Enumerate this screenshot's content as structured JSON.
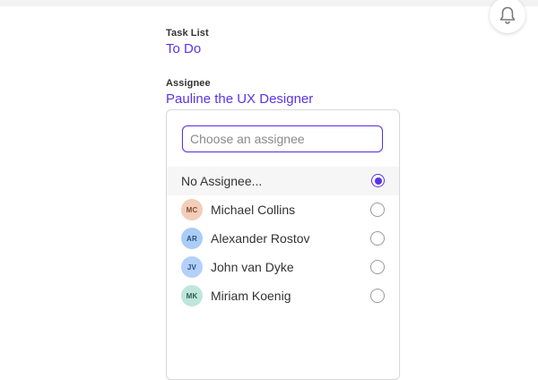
{
  "header": {
    "notifications_icon": "bell-icon"
  },
  "task_list": {
    "label": "Task List",
    "value": "To Do"
  },
  "assignee": {
    "label": "Assignee",
    "value": "Pauline the UX Designer"
  },
  "dropdown": {
    "search_placeholder": "Choose an assignee",
    "search_value": "",
    "options": [
      {
        "label": "No Assignee...",
        "initials": "",
        "avatar_bg": "",
        "avatar_fg": "",
        "selected": true
      },
      {
        "label": "Michael Collins",
        "initials": "MC",
        "avatar_bg": "#f3cdb8",
        "avatar_fg": "#7a4d33",
        "selected": false
      },
      {
        "label": "Alexander Rostov",
        "initials": "AR",
        "avatar_bg": "#a9cdf7",
        "avatar_fg": "#2c4e7a",
        "selected": false
      },
      {
        "label": "John van Dyke",
        "initials": "JV",
        "avatar_bg": "#b3d0fb",
        "avatar_fg": "#2c4e7a",
        "selected": false
      },
      {
        "label": "Miriam Koenig",
        "initials": "MK",
        "avatar_bg": "#bfe6da",
        "avatar_fg": "#2e5e50",
        "selected": false
      }
    ]
  },
  "colors": {
    "accent": "#5b34e6"
  }
}
